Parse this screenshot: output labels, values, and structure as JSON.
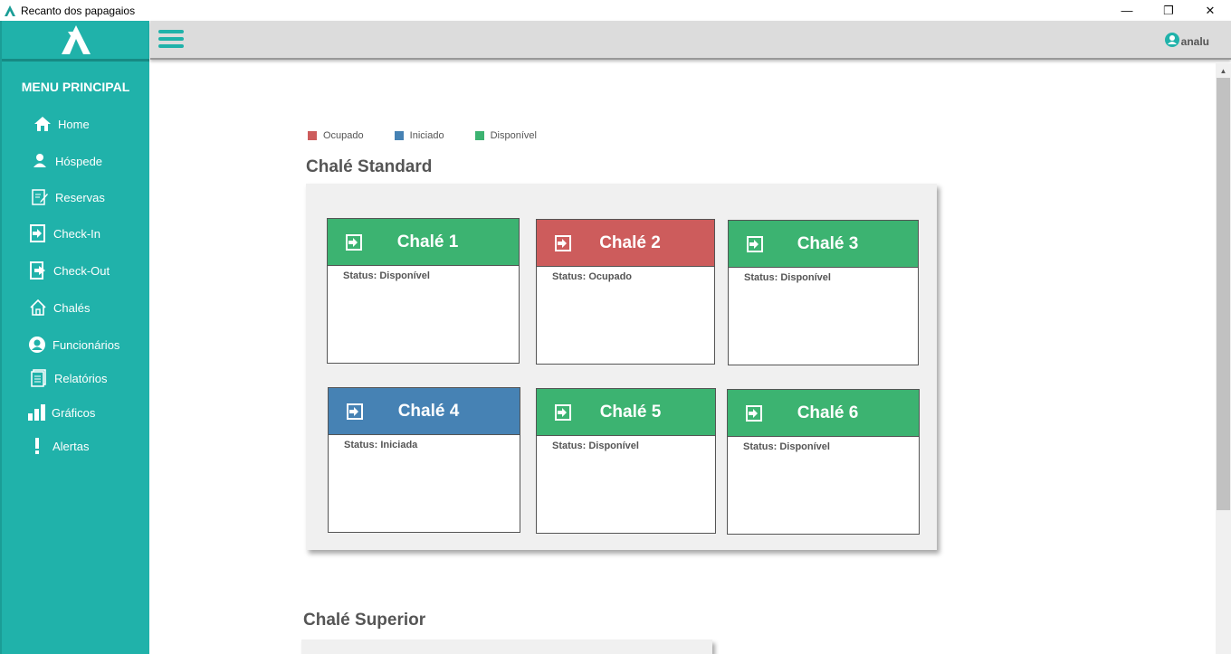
{
  "window": {
    "title": "Recanto dos papagaios",
    "minimize": "—",
    "restore": "❐",
    "close": "✕"
  },
  "sidebar": {
    "menu_title": "MENU PRINCIPAL",
    "items": [
      {
        "label": "Home",
        "icon": "home-icon"
      },
      {
        "label": "Hóspede",
        "icon": "person-icon"
      },
      {
        "label": "Reservas",
        "icon": "edit-document-icon"
      },
      {
        "label": "Check-In",
        "icon": "enter-icon"
      },
      {
        "label": "Check-Out",
        "icon": "exit-icon"
      },
      {
        "label": "Chalés",
        "icon": "house-outline-icon"
      },
      {
        "label": "Funcionários",
        "icon": "user-circle-icon"
      },
      {
        "label": "Relatórios",
        "icon": "report-icon"
      },
      {
        "label": "Gráficos",
        "icon": "bar-chart-icon"
      },
      {
        "label": "Alertas",
        "icon": "exclamation-icon"
      }
    ]
  },
  "topbar": {
    "user": "analu"
  },
  "legend": [
    {
      "label": "Ocupado",
      "color": "#cd5c5c"
    },
    {
      "label": "Iniciado",
      "color": "#4682b4"
    },
    {
      "label": "Disponível",
      "color": "#3cb371"
    }
  ],
  "sections": {
    "standard": {
      "title": "Chalé Standard"
    },
    "superior": {
      "title": "Chalé Superior"
    }
  },
  "chalets": [
    {
      "name": "Chalé 1",
      "status_prefix": "Status: ",
      "status": "Disponível",
      "color": "#3cb371"
    },
    {
      "name": "Chalé 2",
      "status_prefix": "Status: ",
      "status": "Ocupado",
      "color": "#cd5c5c"
    },
    {
      "name": "Chalé 3",
      "status_prefix": "Status: ",
      "status": "Disponível",
      "color": "#3cb371"
    },
    {
      "name": "Chalé 4",
      "status_prefix": "Status: ",
      "status": "Iniciada",
      "color": "#4682b4"
    },
    {
      "name": "Chalé 5",
      "status_prefix": "Status: ",
      "status": "Disponível",
      "color": "#3cb371"
    },
    {
      "name": "Chalé 6",
      "status_prefix": "Status: ",
      "status": "Disponível",
      "color": "#3cb371"
    }
  ]
}
